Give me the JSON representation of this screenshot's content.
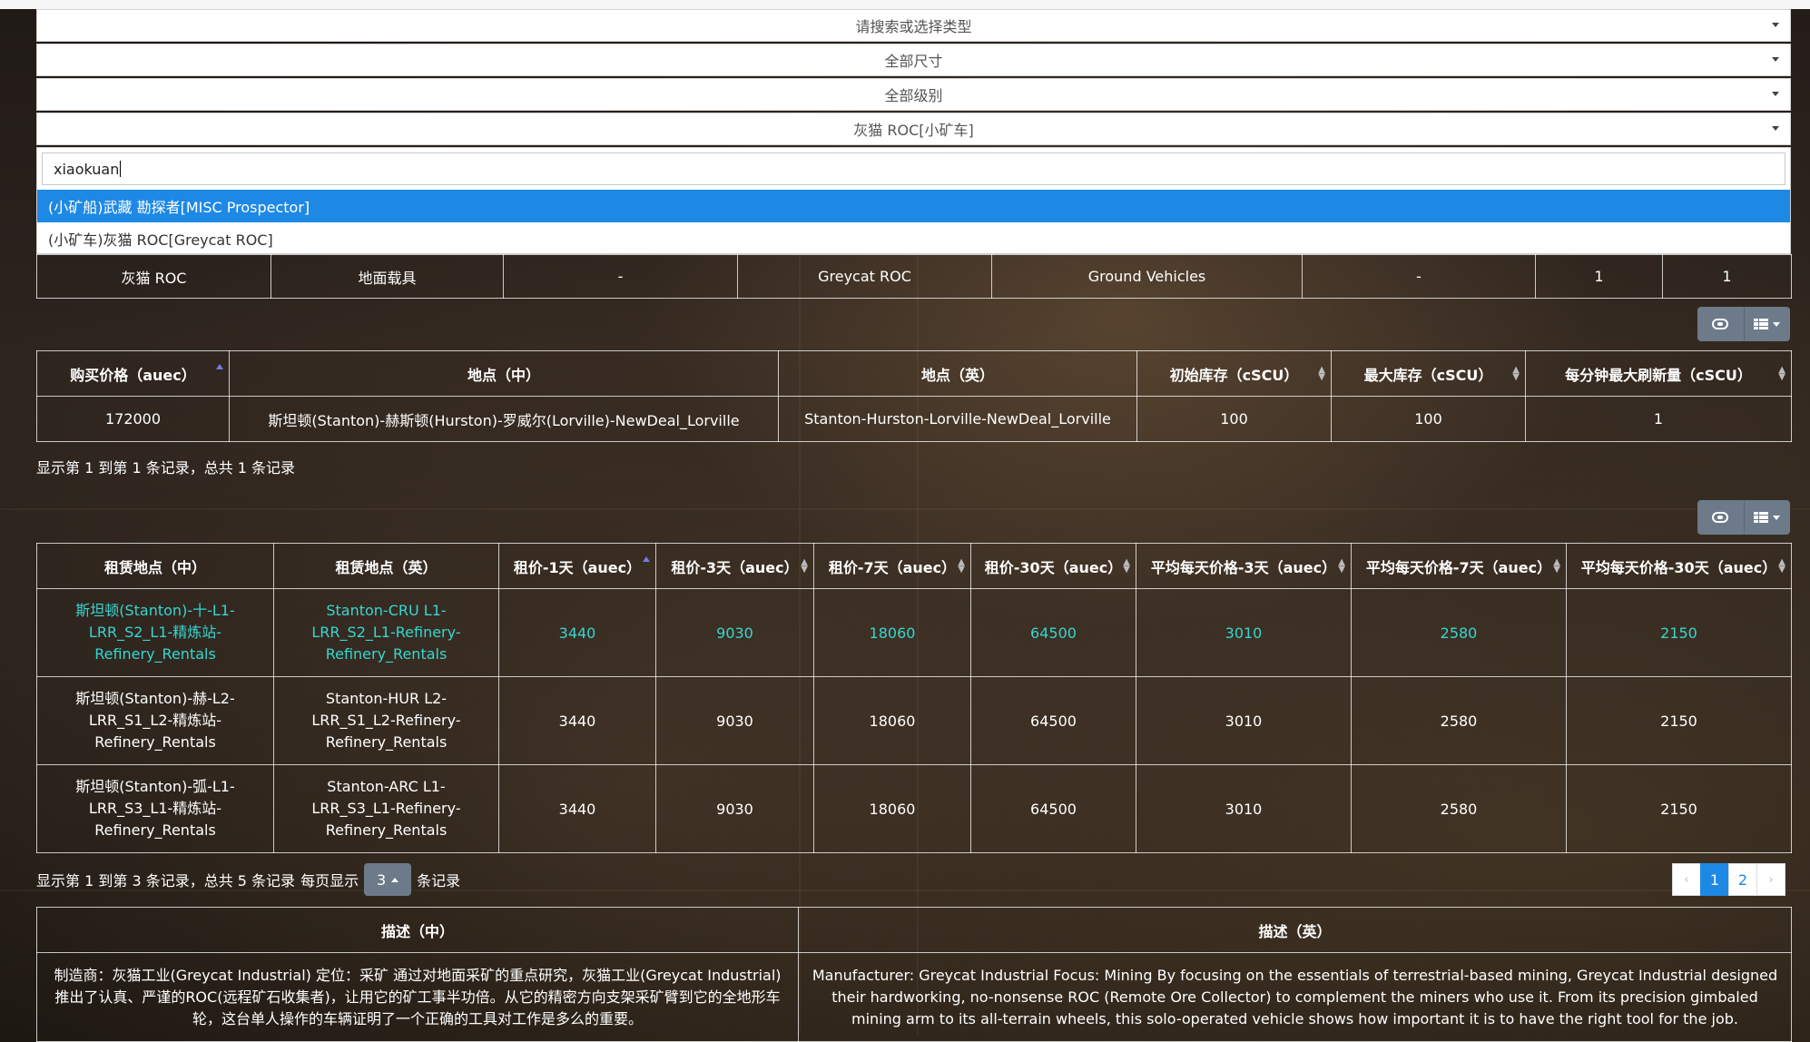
{
  "filters": {
    "type_placeholder": "请搜索或选择类型",
    "size": "全部尺寸",
    "grade": "全部级别",
    "vehicle": "灰猫 ROC[小矿车]"
  },
  "search": {
    "value": "xiaokuan",
    "options": [
      "(小矿船)武藏 勘探者[MISC Prospector]",
      "(小矿车)灰猫 ROC[Greycat ROC]"
    ]
  },
  "vehicle_row": [
    "灰猫 ROC",
    "地面载具",
    "-",
    "Greycat ROC",
    "Ground Vehicles",
    "-",
    "1",
    "1"
  ],
  "buy_table": {
    "headers": [
      "购买价格（auec）",
      "地点（中）",
      "地点（英）",
      "初始库存（cSCU）",
      "最大库存（cSCU）",
      "每分钟最大刷新量（cSCU）"
    ],
    "rows": [
      [
        "172000",
        "斯坦顿(Stanton)-赫斯顿(Hurston)-罗威尔(Lorville)-NewDeal_Lorville",
        "Stanton-Hurston-Lorville-NewDeal_Lorville",
        "100",
        "100",
        "1"
      ]
    ],
    "summary": "显示第 1 到第 1 条记录，总共 1 条记录"
  },
  "rent_table": {
    "headers": [
      "租赁地点（中）",
      "租赁地点（英）",
      "租价-1天（auec）",
      "租价-3天（auec）",
      "租价-7天（auec）",
      "租价-30天（auec）",
      "平均每天价格-3天（auec）",
      "平均每天价格-7天（auec）",
      "平均每天价格-30天（auec）"
    ],
    "rows": [
      [
        "斯坦顿(Stanton)-十-L1-LRR_S2_L1-精炼站-Refinery_Rentals",
        "Stanton-CRU L1-LRR_S2_L1-Refinery-Refinery_Rentals",
        "3440",
        "9030",
        "18060",
        "64500",
        "3010",
        "2580",
        "2150"
      ],
      [
        "斯坦顿(Stanton)-赫-L2-LRR_S1_L2-精炼站-Refinery_Rentals",
        "Stanton-HUR L2-LRR_S1_L2-Refinery-Refinery_Rentals",
        "3440",
        "9030",
        "18060",
        "64500",
        "3010",
        "2580",
        "2150"
      ],
      [
        "斯坦顿(Stanton)-弧-L1-LRR_S3_L1-精炼站-Refinery_Rentals",
        "Stanton-ARC L1-LRR_S3_L1-Refinery-Refinery_Rentals",
        "3440",
        "9030",
        "18060",
        "64500",
        "3010",
        "2580",
        "2150"
      ]
    ],
    "summary_prefix": "显示第 1 到第 3 条记录，总共 5 条记录",
    "per_page_label": "每页显示",
    "per_page_value": "3",
    "per_page_suffix": "条记录",
    "pages": [
      "‹",
      "1",
      "2",
      "›"
    ]
  },
  "desc_table": {
    "headers": [
      "描述（中）",
      "描述（英）"
    ],
    "zh": "制造商：灰猫工业(Greycat Industrial) 定位：采矿 通过对地面采矿的重点研究，灰猫工业(Greycat Industrial)推出了认真、严谨的ROC(远程矿石收集者)，让用它的矿工事半功倍。从它的精密方向支架采矿臂到它的全地形车轮，这台单人操作的车辆证明了一个正确的工具对工作是多么的重要。",
    "en": "Manufacturer: Greycat Industrial Focus: Mining By focusing on the essentials of terrestrial-based mining, Greycat Industrial designed their hardworking, no-nonsense ROC (Remote Ore Collector) to complement the miners who use it. From its precision gimbaled mining arm to its all-terrain wheels, this solo-operated vehicle shows how important it is to have the right tool for the job."
  }
}
